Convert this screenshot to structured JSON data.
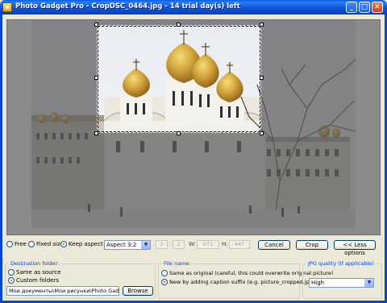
{
  "window": {
    "title": "Photo Gadget Pro - CropDSC_0464.jpg - 14 trial day(s) left",
    "minimize_glyph": "_",
    "maximize_glyph": "□",
    "close_glyph": "✕"
  },
  "crop_modes": {
    "free_label": "Free",
    "fixed_size_label": "Fixed size",
    "keep_aspect_label": "Keep aspect",
    "selected": "keep_aspect"
  },
  "aspect": {
    "selected": "Aspect 3:2",
    "ratio_a": "3",
    "ratio_b": "2",
    "w_label": "W:",
    "w_value": "671",
    "h_label": "H:",
    "h_value": "447"
  },
  "buttons": {
    "cancel": "Cancel",
    "crop": "Crop",
    "less_options": "<< Less options",
    "browse": "Browse"
  },
  "destination": {
    "group_title": "Destination folder:",
    "same_as_source": "Same as source",
    "custom_folders": "Custom folders",
    "selected": "custom_folders",
    "path": "Мои документы\\Мои рисунки\\Photo Gadget Pro"
  },
  "file_name": {
    "group_title": "File name:",
    "same_as_original": "Same as original (careful, this could overwrite original picture!",
    "new_by_suffix": "New by adding caption suffix (e.g. picture_cropped.jpg)",
    "selected": "new_by_suffix"
  },
  "jpg_quality": {
    "group_title": "JPG quality (if applicable)",
    "selected": "High"
  },
  "icons": {
    "app": "photo-gadget-app-icon",
    "dropdown": "chevron-down-icon"
  }
}
